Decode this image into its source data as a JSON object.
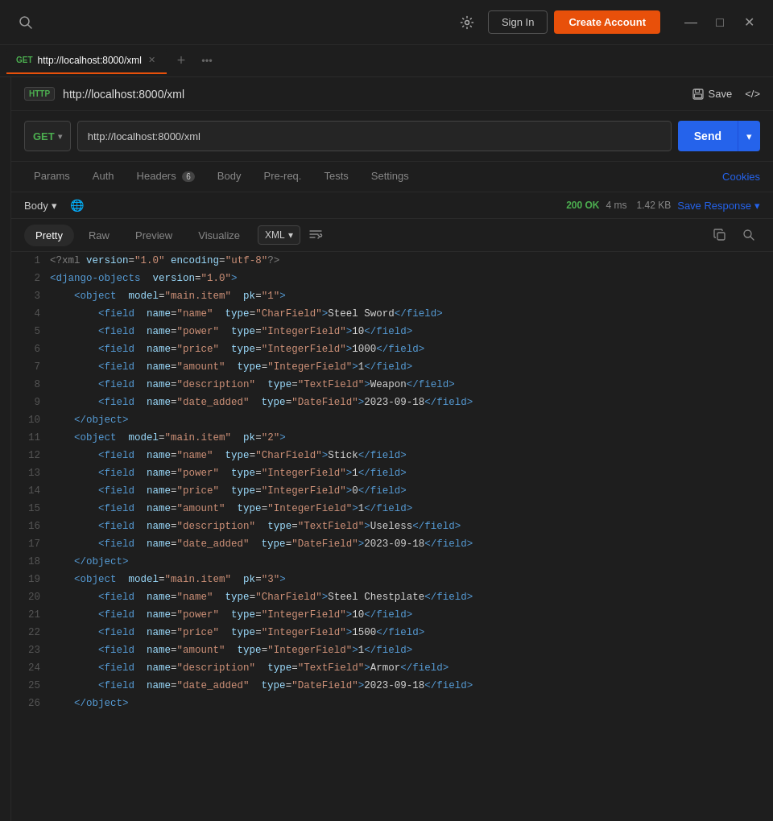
{
  "titlebar": {
    "sign_in_label": "Sign In",
    "create_account_label": "Create Account",
    "minimize_label": "—",
    "maximize_label": "□",
    "close_label": "✕"
  },
  "tab": {
    "method": "GET",
    "url": "http://localhost:8000/xml",
    "add_label": "+",
    "more_label": "•••"
  },
  "request_header": {
    "http_badge": "HTTP",
    "url_title": "http://localhost:8000/xml",
    "save_label": "Save",
    "code_label": "</>"
  },
  "url_bar": {
    "method": "GET",
    "url_value": "http://localhost:8000/xml",
    "send_label": "Send"
  },
  "nav_tabs": {
    "items": [
      {
        "label": "Params",
        "active": false,
        "badge": null
      },
      {
        "label": "Auth",
        "active": false,
        "badge": null
      },
      {
        "label": "Headers",
        "active": false,
        "badge": "6"
      },
      {
        "label": "Body",
        "active": false,
        "badge": null
      },
      {
        "label": "Pre-req.",
        "active": false,
        "badge": null
      },
      {
        "label": "Tests",
        "active": false,
        "badge": null
      },
      {
        "label": "Settings",
        "active": false,
        "badge": null
      }
    ],
    "cookies_label": "Cookies"
  },
  "response_header": {
    "body_label": "Body",
    "status": "200 OK",
    "time": "4 ms",
    "size": "1.42 KB",
    "save_response_label": "Save Response"
  },
  "response_tabs": {
    "items": [
      {
        "label": "Pretty",
        "active": true
      },
      {
        "label": "Raw",
        "active": false
      },
      {
        "label": "Preview",
        "active": false
      },
      {
        "label": "Visualize",
        "active": false
      }
    ],
    "format": "XML"
  },
  "code_lines": [
    {
      "num": 1,
      "content": "<?xml version=\"1.0\" encoding=\"utf-8\"?>"
    },
    {
      "num": 2,
      "content": "<django-objects version=\"1.0\">"
    },
    {
      "num": 3,
      "content": "    <object model=\"main.item\" pk=\"1\">"
    },
    {
      "num": 4,
      "content": "        <field name=\"name\" type=\"CharField\">Steel Sword</field>"
    },
    {
      "num": 5,
      "content": "        <field name=\"power\" type=\"IntegerField\">10</field>"
    },
    {
      "num": 6,
      "content": "        <field name=\"price\" type=\"IntegerField\">1000</field>"
    },
    {
      "num": 7,
      "content": "        <field name=\"amount\" type=\"IntegerField\">1</field>"
    },
    {
      "num": 8,
      "content": "        <field name=\"description\" type=\"TextField\">Weapon</field>"
    },
    {
      "num": 9,
      "content": "        <field name=\"date_added\" type=\"DateField\">2023-09-18</field>"
    },
    {
      "num": 10,
      "content": "    </object>"
    },
    {
      "num": 11,
      "content": "    <object model=\"main.item\" pk=\"2\">"
    },
    {
      "num": 12,
      "content": "        <field name=\"name\" type=\"CharField\">Stick</field>"
    },
    {
      "num": 13,
      "content": "        <field name=\"power\" type=\"IntegerField\">1</field>"
    },
    {
      "num": 14,
      "content": "        <field name=\"price\" type=\"IntegerField\">0</field>"
    },
    {
      "num": 15,
      "content": "        <field name=\"amount\" type=\"IntegerField\">1</field>"
    },
    {
      "num": 16,
      "content": "        <field name=\"description\" type=\"TextField\">Useless</field>"
    },
    {
      "num": 17,
      "content": "        <field name=\"date_added\" type=\"DateField\">2023-09-18</field>"
    },
    {
      "num": 18,
      "content": "    </object>"
    },
    {
      "num": 19,
      "content": "    <object model=\"main.item\" pk=\"3\">"
    },
    {
      "num": 20,
      "content": "        <field name=\"name\" type=\"CharField\">Steel Chestplate</field>"
    },
    {
      "num": 21,
      "content": "        <field name=\"power\" type=\"IntegerField\">10</field>"
    },
    {
      "num": 22,
      "content": "        <field name=\"price\" type=\"IntegerField\">1500</field>"
    },
    {
      "num": 23,
      "content": "        <field name=\"amount\" type=\"IntegerField\">1</field>"
    },
    {
      "num": 24,
      "content": "        <field name=\"description\" type=\"TextField\">Armor</field>"
    },
    {
      "num": 25,
      "content": "        <field name=\"date_added\" type=\"DateField\">2023-09-18</field>"
    },
    {
      "num": 26,
      "content": "    </object>"
    }
  ],
  "bottom_bar": {
    "layout_icon": "⊞",
    "help_icon": "?"
  }
}
